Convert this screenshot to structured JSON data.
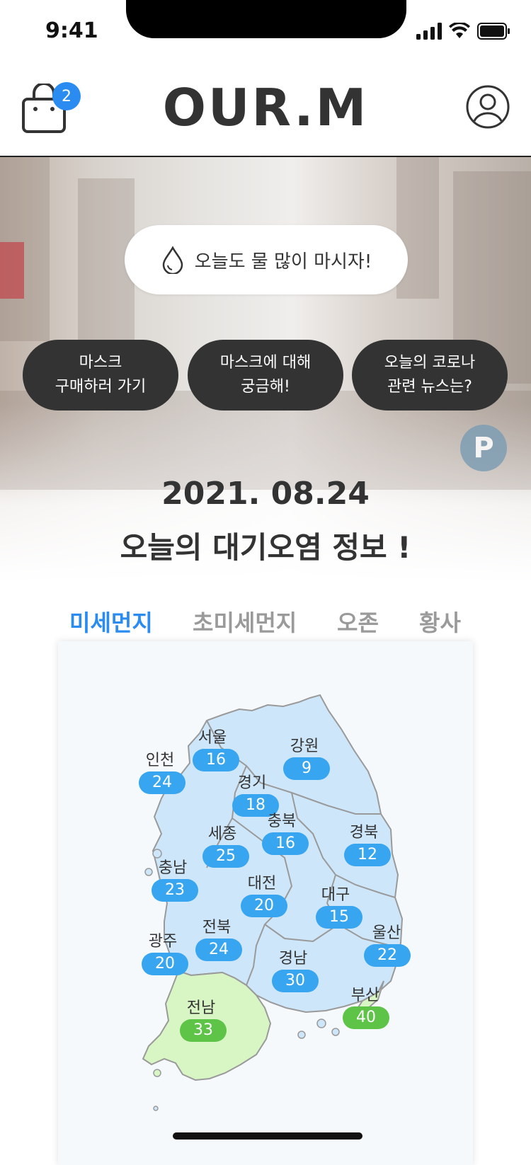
{
  "status_bar": {
    "time": "9:41"
  },
  "header": {
    "logo": "OUR.M",
    "cart_count": "2"
  },
  "hero": {
    "water_message": "오늘도 물 많이 마시자!",
    "buttons": [
      {
        "label": "마스크\n구매하러 가기"
      },
      {
        "label": "마스크에 대해\n궁금해!"
      },
      {
        "label": "오늘의 코로나\n관련 뉴스는?"
      }
    ],
    "date": "2021. 08.24",
    "title": "오늘의 대기오염 정보 !"
  },
  "tabs": [
    {
      "label": "미세먼지",
      "active": true
    },
    {
      "label": "초미세먼지",
      "active": false
    },
    {
      "label": "오존",
      "active": false
    },
    {
      "label": "황사",
      "active": false
    }
  ],
  "regions": [
    {
      "name": "서울",
      "value": "16",
      "level": "blue"
    },
    {
      "name": "강원",
      "value": "9",
      "level": "blue"
    },
    {
      "name": "인천",
      "value": "24",
      "level": "blue"
    },
    {
      "name": "경기",
      "value": "18",
      "level": "blue"
    },
    {
      "name": "충북",
      "value": "16",
      "level": "blue"
    },
    {
      "name": "경북",
      "value": "12",
      "level": "blue"
    },
    {
      "name": "세종",
      "value": "25",
      "level": "blue"
    },
    {
      "name": "충남",
      "value": "23",
      "level": "blue"
    },
    {
      "name": "대전",
      "value": "20",
      "level": "blue"
    },
    {
      "name": "대구",
      "value": "15",
      "level": "blue"
    },
    {
      "name": "전북",
      "value": "24",
      "level": "blue"
    },
    {
      "name": "광주",
      "value": "20",
      "level": "blue"
    },
    {
      "name": "울산",
      "value": "22",
      "level": "blue"
    },
    {
      "name": "경남",
      "value": "30",
      "level": "blue"
    },
    {
      "name": "부산",
      "value": "40",
      "level": "green"
    },
    {
      "name": "전남",
      "value": "33",
      "level": "green"
    }
  ],
  "colors": {
    "accent": "#2a8cf0",
    "badge_blue": "#37a5f0",
    "badge_green": "#5dc447",
    "map_blue": "#cde6fa",
    "map_green": "#d8f5c4"
  },
  "icons": {
    "cart": "shopping-bag-icon",
    "profile": "user-icon",
    "water": "water-drop-icon"
  }
}
